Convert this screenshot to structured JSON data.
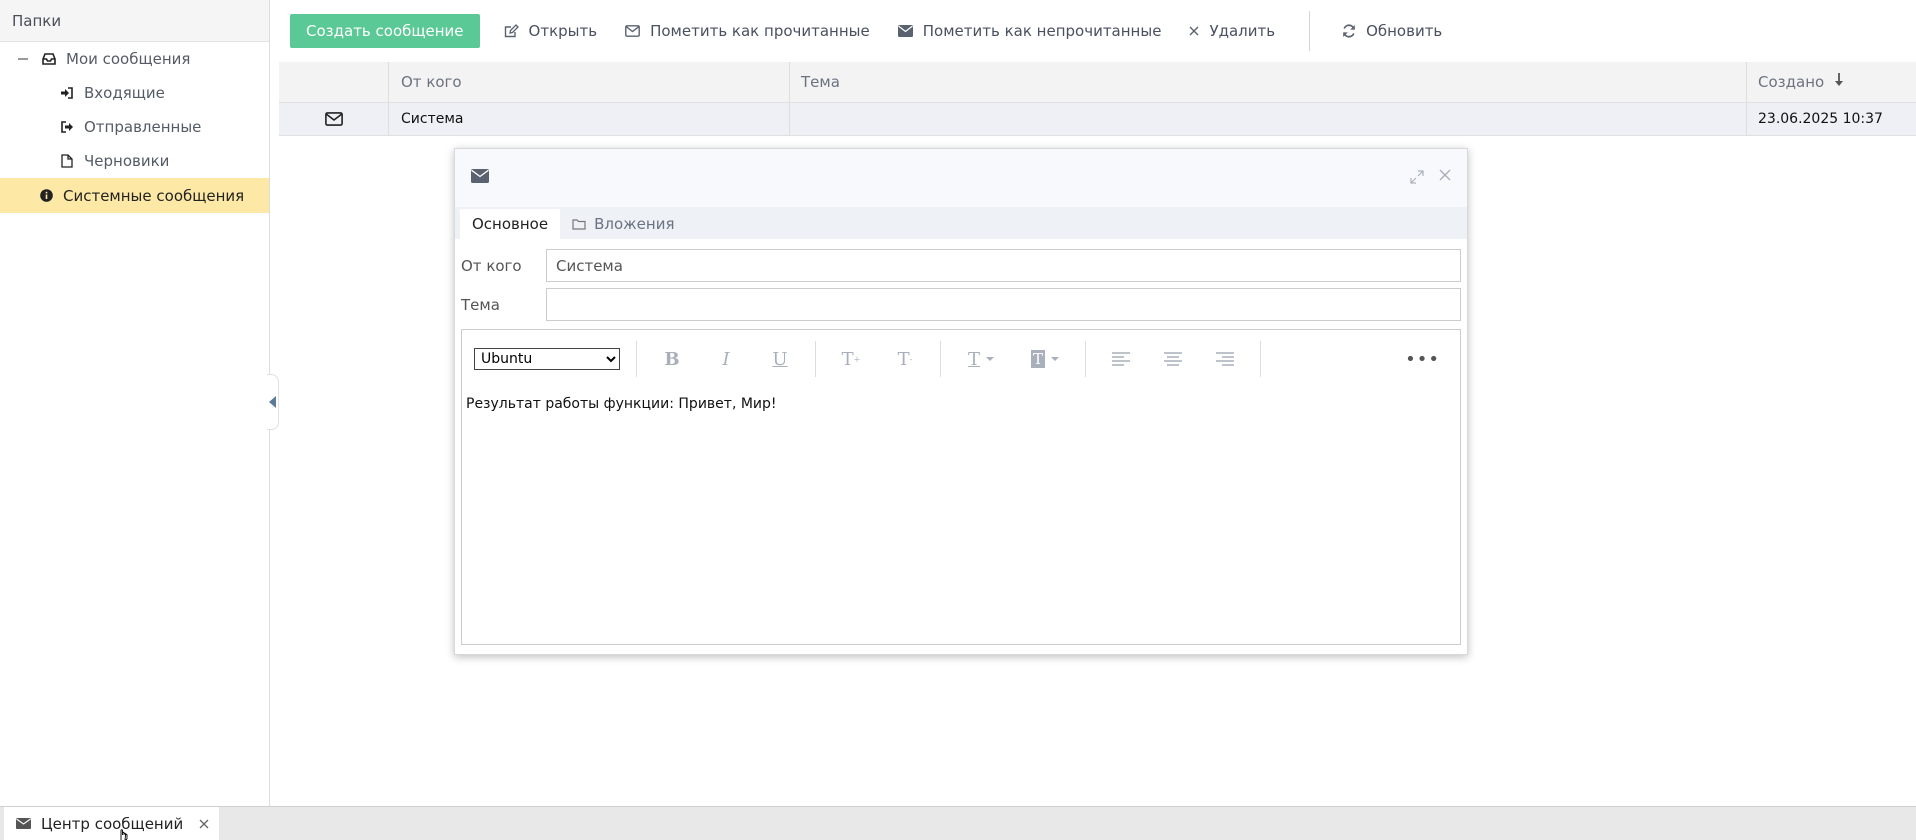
{
  "sidebar": {
    "header": "Папки",
    "my_messages": "Мои сообщения",
    "inbox": "Входящие",
    "sent": "Отправленные",
    "drafts": "Черновики",
    "system_messages": "Системные сообщения"
  },
  "toolbar": {
    "create": "Создать сообщение",
    "open": "Открыть",
    "mark_read": "Пометить как прочитанные",
    "mark_unread": "Пометить как непрочитанные",
    "delete": "Удалить",
    "refresh": "Обновить"
  },
  "grid": {
    "columns": {
      "from": "От кого",
      "subject": "Тема",
      "created": "Создано"
    },
    "rows": [
      {
        "from": "Система",
        "subject": "",
        "created": "23.06.2025 10:37"
      }
    ]
  },
  "dialog": {
    "tabs": {
      "main": "Основное",
      "attachments": "Вложения"
    },
    "from_label": "От кого",
    "from_value": "Система",
    "subject_label": "Тема",
    "subject_value": "",
    "font_select": "Ubuntu",
    "body": "Результат работы функции: Привет, Мир!"
  },
  "taskbar": {
    "tab_label": "Центр сообщений"
  },
  "colors": {
    "primary_button": "#5bc995",
    "selected_folder": "#fde9a5",
    "row_highlight": "#eef0f6"
  }
}
